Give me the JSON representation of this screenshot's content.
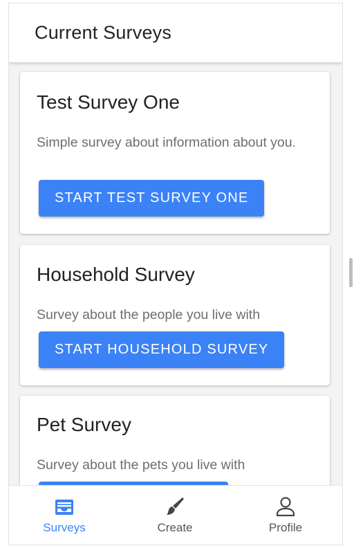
{
  "header": {
    "title": "Current Surveys"
  },
  "surveys": [
    {
      "title": "Test Survey One",
      "description": "Simple survey about information about you.",
      "button_label": "START TEST SURVEY ONE"
    },
    {
      "title": "Household Survey",
      "description": "Survey about the people you live with",
      "button_label": "START HOUSEHOLD SURVEY"
    },
    {
      "title": "Pet Survey",
      "description": "Survey about the pets you live with",
      "button_label": ""
    }
  ],
  "bottom_nav": {
    "items": [
      {
        "label": "Surveys",
        "icon": "inbox-icon",
        "active": true
      },
      {
        "label": "Create",
        "icon": "brush-icon",
        "active": false
      },
      {
        "label": "Profile",
        "icon": "person-icon",
        "active": false
      }
    ]
  },
  "colors": {
    "accent": "#3b82f6",
    "text_primary": "#222222",
    "text_secondary": "#6e6e6e",
    "background": "#f3f3f3"
  }
}
